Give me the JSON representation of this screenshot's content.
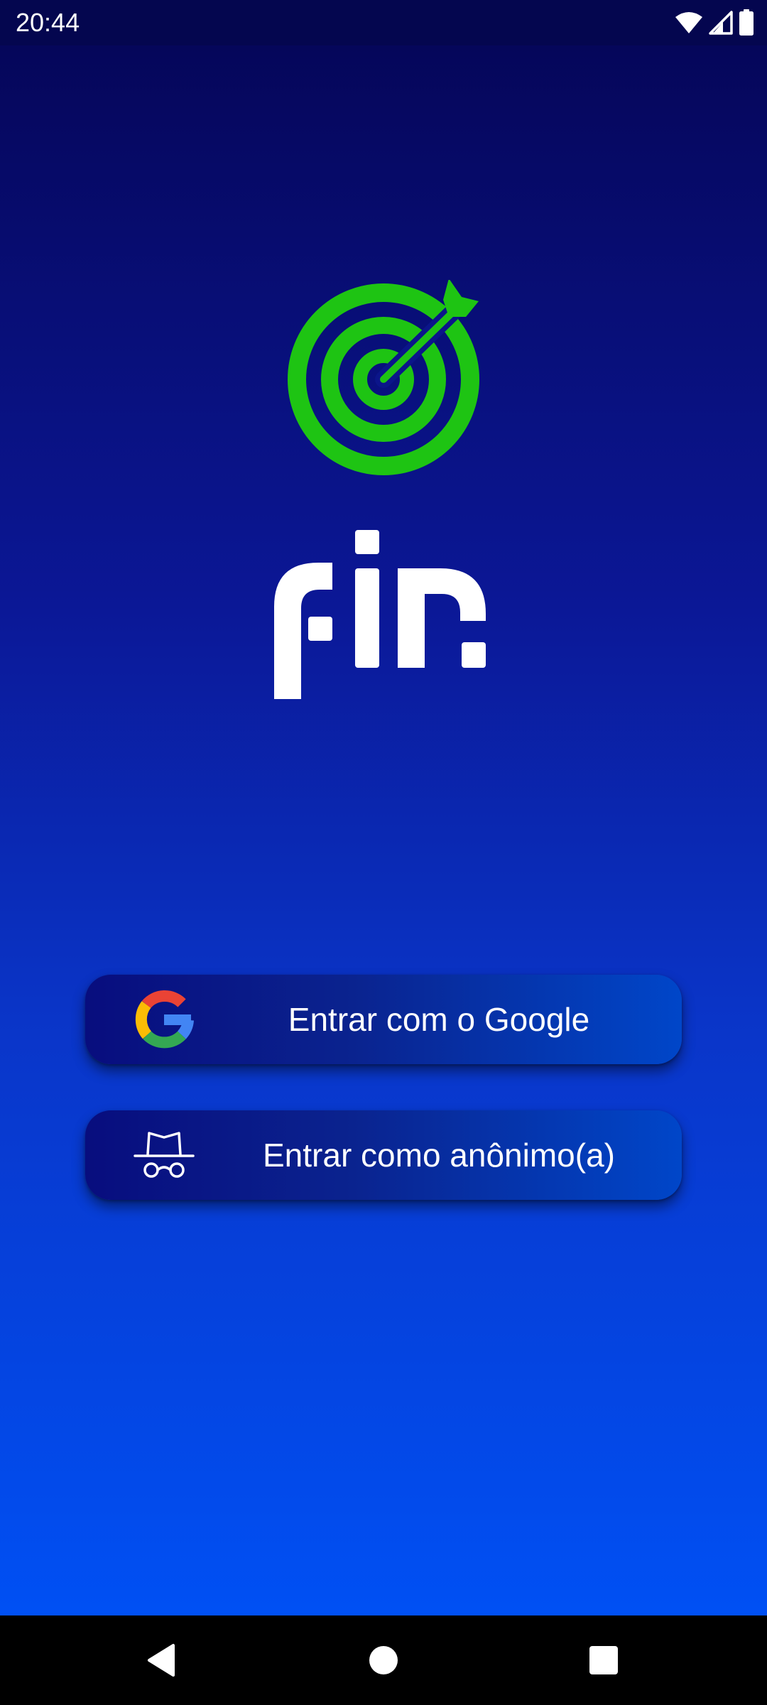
{
  "status_bar": {
    "time": "20:44",
    "icons": [
      "wifi-icon",
      "cell-signal-icon",
      "battery-icon"
    ]
  },
  "logo": {
    "text": "fin",
    "icon": "target-arrow-logo",
    "accent_color": "#1ec413"
  },
  "buttons": {
    "google": {
      "label": "Entrar com o Google",
      "icon": "google-icon"
    },
    "anonymous": {
      "label": "Entrar como anônimo(a)",
      "icon": "incognito-icon"
    }
  },
  "nav_bar": {
    "icons": [
      "back-icon",
      "home-icon",
      "recents-icon"
    ]
  },
  "colors": {
    "gradient_top": "#05065a",
    "gradient_bottom": "#0050f4",
    "button_left": "#080d7e",
    "button_right": "#0046c9"
  }
}
